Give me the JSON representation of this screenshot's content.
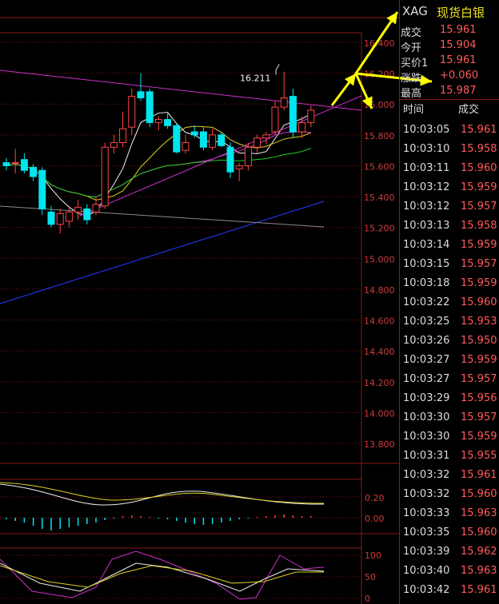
{
  "quote": {
    "symbol": "XAG",
    "name": "现货白银",
    "rows": [
      {
        "label": "成交",
        "value": "15.961"
      },
      {
        "label": "今开",
        "value": "15.904"
      },
      {
        "label": "买价1",
        "value": "15.961"
      },
      {
        "label": "涨跌",
        "value": "+0.060"
      },
      {
        "label": "最高",
        "value": "15.987"
      }
    ]
  },
  "ticks": {
    "header_time": "时间",
    "header_price": "成交",
    "rows": [
      {
        "time": "10:03:05",
        "price": "15.961"
      },
      {
        "time": "10:03:10",
        "price": "15.958"
      },
      {
        "time": "10:03:11",
        "price": "15.960"
      },
      {
        "time": "10:03:12",
        "price": "15.959"
      },
      {
        "time": "10:03:12",
        "price": "15.957"
      },
      {
        "time": "10:03:13",
        "price": "15.958"
      },
      {
        "time": "10:03:14",
        "price": "15.959"
      },
      {
        "time": "10:03:15",
        "price": "15.957"
      },
      {
        "time": "10:03:18",
        "price": "15.959"
      },
      {
        "time": "10:03:22",
        "price": "15.960"
      },
      {
        "time": "10:03:25",
        "price": "15.953"
      },
      {
        "time": "10:03:26",
        "price": "15.950"
      },
      {
        "time": "10:03:27",
        "price": "15.959"
      },
      {
        "time": "10:03:27",
        "price": "15.957"
      },
      {
        "time": "10:03:29",
        "price": "15.956"
      },
      {
        "time": "10:03:30",
        "price": "15.957"
      },
      {
        "time": "10:03:30",
        "price": "15.959"
      },
      {
        "time": "10:03:31",
        "price": "15.955"
      },
      {
        "time": "10:03:32",
        "price": "15.961"
      },
      {
        "time": "10:03:32",
        "price": "15.960"
      },
      {
        "time": "10:03:33",
        "price": "15.963"
      },
      {
        "time": "10:03:35",
        "price": "15.960"
      },
      {
        "time": "10:03:39",
        "price": "15.962"
      },
      {
        "time": "10:03:40",
        "price": "15.963"
      },
      {
        "time": "10:03:42",
        "price": "15.961"
      }
    ]
  },
  "colors": {
    "up": "#ff4444",
    "down": "#00e5ee",
    "grid": "#8a1b1b",
    "ma5": "#f2f2f2",
    "ma10": "#e0d020",
    "ma20": "#d030d0",
    "ma30": "#20d020",
    "ma60": "#2030e0",
    "arrow": "#ffff00"
  },
  "chart_data": {
    "type": "candlestick",
    "price_axis": {
      "ylim": [
        13.8,
        16.4
      ],
      "ticks": [
        "16.400",
        "16.200",
        "16.000",
        "15.800",
        "15.600",
        "15.400",
        "15.200",
        "15.000",
        "14.800",
        "14.600",
        "14.400",
        "14.200",
        "14.000",
        "13.800"
      ]
    },
    "annotation": "16.211",
    "candles": [
      {
        "o": 15.62,
        "h": 15.65,
        "l": 15.57,
        "c": 15.6
      },
      {
        "o": 15.62,
        "h": 15.71,
        "l": 15.55,
        "c": 15.62
      },
      {
        "o": 15.64,
        "h": 15.68,
        "l": 15.55,
        "c": 15.57
      },
      {
        "o": 15.59,
        "h": 15.61,
        "l": 15.5,
        "c": 15.53
      },
      {
        "o": 15.57,
        "h": 15.59,
        "l": 15.28,
        "c": 15.32
      },
      {
        "o": 15.3,
        "h": 15.34,
        "l": 15.2,
        "c": 15.22
      },
      {
        "o": 15.22,
        "h": 15.32,
        "l": 15.16,
        "c": 15.29
      },
      {
        "o": 15.24,
        "h": 15.34,
        "l": 15.2,
        "c": 15.3
      },
      {
        "o": 15.3,
        "h": 15.38,
        "l": 15.25,
        "c": 15.33
      },
      {
        "o": 15.32,
        "h": 15.35,
        "l": 15.22,
        "c": 15.25
      },
      {
        "o": 15.3,
        "h": 15.4,
        "l": 15.28,
        "c": 15.35
      },
      {
        "o": 15.34,
        "h": 15.75,
        "l": 15.32,
        "c": 15.72
      },
      {
        "o": 15.72,
        "h": 15.8,
        "l": 15.68,
        "c": 15.75
      },
      {
        "o": 15.75,
        "h": 15.95,
        "l": 15.72,
        "c": 15.84
      },
      {
        "o": 15.85,
        "h": 16.1,
        "l": 15.8,
        "c": 16.05
      },
      {
        "o": 16.08,
        "h": 16.2,
        "l": 16.02,
        "c": 16.04
      },
      {
        "o": 16.08,
        "h": 16.1,
        "l": 15.85,
        "c": 15.88
      },
      {
        "o": 15.88,
        "h": 15.92,
        "l": 15.83,
        "c": 15.9
      },
      {
        "o": 15.9,
        "h": 15.95,
        "l": 15.84,
        "c": 15.86
      },
      {
        "o": 15.86,
        "h": 15.87,
        "l": 15.68,
        "c": 15.69
      },
      {
        "o": 15.7,
        "h": 15.8,
        "l": 15.68,
        "c": 15.75
      },
      {
        "o": 15.82,
        "h": 15.86,
        "l": 15.78,
        "c": 15.8
      },
      {
        "o": 15.82,
        "h": 15.85,
        "l": 15.7,
        "c": 15.72
      },
      {
        "o": 15.72,
        "h": 15.84,
        "l": 15.7,
        "c": 15.8
      },
      {
        "o": 15.8,
        "h": 15.82,
        "l": 15.72,
        "c": 15.73
      },
      {
        "o": 15.72,
        "h": 15.75,
        "l": 15.52,
        "c": 15.56
      },
      {
        "o": 15.58,
        "h": 15.62,
        "l": 15.5,
        "c": 15.6
      },
      {
        "o": 15.6,
        "h": 15.75,
        "l": 15.57,
        "c": 15.72
      },
      {
        "o": 15.72,
        "h": 15.8,
        "l": 15.68,
        "c": 15.78
      },
      {
        "o": 15.78,
        "h": 15.82,
        "l": 15.74,
        "c": 15.8
      },
      {
        "o": 15.82,
        "h": 16.02,
        "l": 15.8,
        "c": 15.98
      },
      {
        "o": 15.98,
        "h": 16.21,
        "l": 15.96,
        "c": 16.04
      },
      {
        "o": 16.05,
        "h": 16.1,
        "l": 15.78,
        "c": 15.82
      },
      {
        "o": 15.82,
        "h": 15.92,
        "l": 15.78,
        "c": 15.88
      },
      {
        "o": 15.88,
        "h": 15.99,
        "l": 15.85,
        "c": 15.96
      }
    ],
    "macd_axis": {
      "ticks": [
        "0.20",
        "0.00"
      ]
    },
    "kdj_axis": {
      "ticks": [
        "100",
        "50",
        "0"
      ]
    }
  }
}
